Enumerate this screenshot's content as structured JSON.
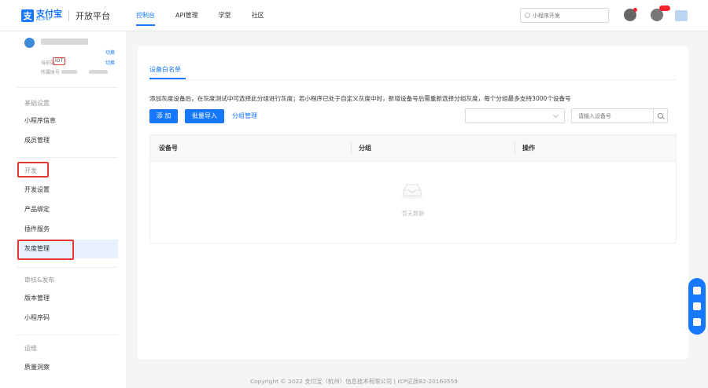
{
  "header": {
    "logo_cn": "支付宝",
    "logo_en": "ALIPAY",
    "platform": "开放平台",
    "nav": [
      "控制台",
      "API管理",
      "学堂",
      "社区"
    ],
    "search_placeholder": "小程序开发"
  },
  "sidebar": {
    "current_env_label": "当前端",
    "current_env_value": "IOT",
    "account_label": "所属账号",
    "switch_label": "切换",
    "groups": {
      "basic": "基础设置",
      "dev": "开发",
      "review": "审核&发布",
      "ops": "运维"
    },
    "items": {
      "app_info": "小程序信息",
      "members": "成员管理",
      "dev_settings": "开发设置",
      "product_binding": "产品绑定",
      "plugin_service": "插件服务",
      "grayscale": "灰度管理",
      "version": "版本管理",
      "qrcode": "小程序码",
      "quality": "质量洞察"
    }
  },
  "main": {
    "tab": "设备白名单",
    "notice": "添加灰度设备后，在灰度测试中可选择此分组进行灰度；若小程序已处于自定义灰度中时，新增设备号后需重新选择分组灰度，每个分组最多支持3000个设备号",
    "btn_add": "添 加",
    "btn_import": "批量导入",
    "link_groups": "分组管理",
    "device_placeholder": "请输入设备号",
    "table": {
      "columns": [
        "设备号",
        "分组",
        "操作"
      ],
      "empty": "暂无数据"
    }
  },
  "footer": "Copyright © 2022 支付宝（杭州）信息技术有限公司 | ICP证浙B2-20160559"
}
